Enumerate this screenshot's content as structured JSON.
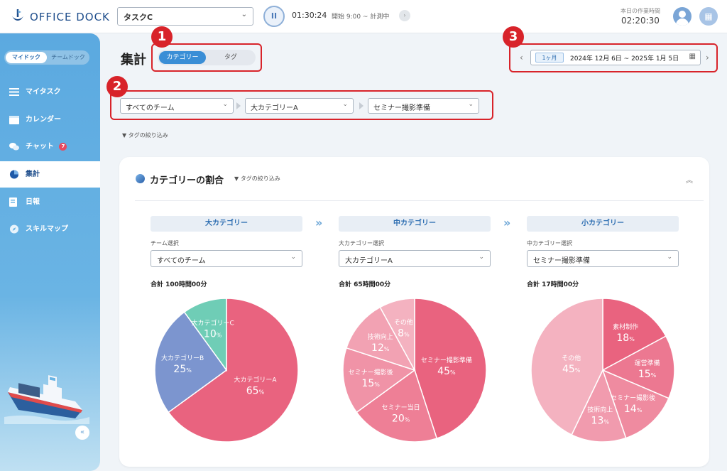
{
  "header": {
    "logo_text": "OFFICE DOCK",
    "task_select": "タスクC",
    "timer": "01:30:24",
    "start_info": "開始 9:00 ~ 計測中",
    "work_label": "本日の作業時間",
    "work_time": "02:20:30",
    "icons": [
      "logo-icon",
      "pause-icon",
      "chevron-right-icon",
      "user-avatar-icon",
      "company-icon"
    ]
  },
  "sidebar": {
    "toggle_on": "マイドック",
    "toggle_off": "チームドック",
    "items": [
      {
        "label": "マイタスク",
        "icon": "list-icon",
        "badge": ""
      },
      {
        "label": "カレンダー",
        "icon": "calendar-icon",
        "badge": ""
      },
      {
        "label": "チャット",
        "icon": "chat-icon",
        "badge": "7"
      },
      {
        "label": "集計",
        "icon": "pie-chart-icon",
        "badge": ""
      },
      {
        "label": "日報",
        "icon": "report-icon",
        "badge": ""
      },
      {
        "label": "スキルマップ",
        "icon": "compass-icon",
        "badge": ""
      }
    ],
    "active_index": 3,
    "collapse": "«"
  },
  "main": {
    "title": "集計",
    "tabs": [
      "カテゴリー",
      "タグ"
    ],
    "period": "1ヶ月",
    "date_range": "2024年 12月 6日 ~ 2025年 1月 5日",
    "filters": [
      "すべてのチーム",
      "大カテゴリーA",
      "セミナー撮影準備"
    ],
    "tag_filter": "タグの絞り込み",
    "callouts": [
      "1",
      "2",
      "3"
    ]
  },
  "card": {
    "title": "カテゴリーの割合",
    "tag_filter": "タグの絞り込み",
    "columns": [
      {
        "head": "大カテゴリー",
        "label": "チーム選択",
        "select": "すべてのチーム",
        "total": "合計 100時間00分"
      },
      {
        "head": "中カテゴリー",
        "label": "大カテゴリー選択",
        "select": "大カテゴリーA",
        "total": "合計 65時間00分"
      },
      {
        "head": "小カテゴリー",
        "label": "中カテゴリー選択",
        "select": "セミナー撮影準備",
        "total": "合計 17時間00分"
      }
    ]
  },
  "chart_data": [
    {
      "type": "pie",
      "slices": [
        {
          "label": "大カテゴリーA",
          "value": 65,
          "color": "#e9637f"
        },
        {
          "label": "大カテゴリーB",
          "value": 25,
          "color": "#7c95cf"
        },
        {
          "label": "大カテゴリーC",
          "value": 10,
          "color": "#6fcdb6"
        }
      ]
    },
    {
      "type": "pie",
      "slices": [
        {
          "label": "セミナー撮影準備",
          "value": 45,
          "color": "#e9637f"
        },
        {
          "label": "セミナー当日",
          "value": 20,
          "color": "#ee7f96"
        },
        {
          "label": "セミナー撮影後",
          "value": 15,
          "color": "#f093a7"
        },
        {
          "label": "技術向上",
          "value": 12,
          "color": "#f2a2b3"
        },
        {
          "label": "その他",
          "value": 8,
          "color": "#f4b2c0"
        }
      ]
    },
    {
      "type": "pie",
      "slices": [
        {
          "label": "素材制作",
          "value": 18,
          "color": "#e9637f"
        },
        {
          "label": "運営準備",
          "value": 15,
          "color": "#ec7891"
        },
        {
          "label": "セミナー撮影後",
          "value": 14,
          "color": "#ef8ba0"
        },
        {
          "label": "技術向上",
          "value": 13,
          "color": "#f19bae"
        },
        {
          "label": "その他",
          "value": 45,
          "color": "#f4b2c0"
        }
      ]
    }
  ]
}
